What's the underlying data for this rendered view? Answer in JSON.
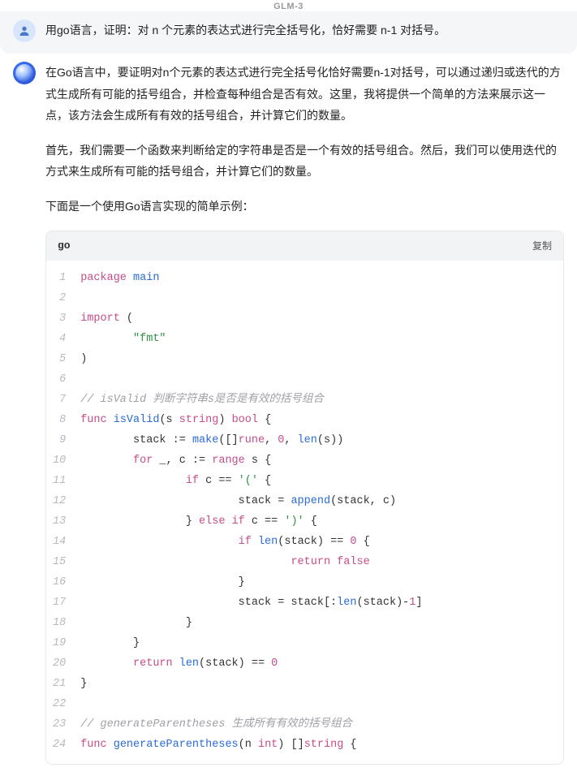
{
  "model_name": "GLM-3",
  "user": {
    "text": "用go语言，证明：对 n 个元素的表达式进行完全括号化，恰好需要 n-1 对括号。"
  },
  "assistant": {
    "paragraphs": [
      "在Go语言中，要证明对n个元素的表达式进行完全括号化恰好需要n-1对括号，可以通过递归或迭代的方式生成所有可能的括号组合，并检查每种组合是否有效。这里，我将提供一个简单的方法来展示这一点，该方法会生成所有有效的括号组合，并计算它们的数量。",
      "首先，我们需要一个函数来判断给定的字符串是否是一个有效的括号组合。然后，我们可以使用迭代的方式来生成所有可能的括号组合，并计算它们的数量。",
      "下面是一个使用Go语言实现的简单示例："
    ]
  },
  "code": {
    "language": "go",
    "copy_label": "复制",
    "lines": [
      {
        "n": 1,
        "tokens": [
          [
            "kw",
            "package"
          ],
          [
            "plain",
            " "
          ],
          [
            "fn",
            "main"
          ]
        ]
      },
      {
        "n": 2,
        "tokens": []
      },
      {
        "n": 3,
        "tokens": [
          [
            "kw",
            "import"
          ],
          [
            "plain",
            " ("
          ]
        ]
      },
      {
        "n": 4,
        "tokens": [
          [
            "plain",
            "        "
          ],
          [
            "str",
            "\"fmt\""
          ]
        ]
      },
      {
        "n": 5,
        "tokens": [
          [
            "plain",
            ")"
          ]
        ]
      },
      {
        "n": 6,
        "tokens": []
      },
      {
        "n": 7,
        "tokens": [
          [
            "comment",
            "// isValid 判断字符串s是否是有效的括号组合"
          ]
        ]
      },
      {
        "n": 8,
        "tokens": [
          [
            "kw",
            "func"
          ],
          [
            "plain",
            " "
          ],
          [
            "fn",
            "isValid"
          ],
          [
            "plain",
            "(s "
          ],
          [
            "type",
            "string"
          ],
          [
            "plain",
            ") "
          ],
          [
            "type",
            "bool"
          ],
          [
            "plain",
            " {"
          ]
        ]
      },
      {
        "n": 9,
        "tokens": [
          [
            "plain",
            "        stack := "
          ],
          [
            "fn",
            "make"
          ],
          [
            "plain",
            "([]"
          ],
          [
            "type",
            "rune"
          ],
          [
            "plain",
            ", "
          ],
          [
            "num",
            "0"
          ],
          [
            "plain",
            ", "
          ],
          [
            "fn",
            "len"
          ],
          [
            "plain",
            "(s))"
          ]
        ]
      },
      {
        "n": 10,
        "tokens": [
          [
            "plain",
            "        "
          ],
          [
            "kw",
            "for"
          ],
          [
            "plain",
            " _, c := "
          ],
          [
            "kw",
            "range"
          ],
          [
            "plain",
            " s {"
          ]
        ]
      },
      {
        "n": 11,
        "tokens": [
          [
            "plain",
            "                "
          ],
          [
            "kw",
            "if"
          ],
          [
            "plain",
            " c == "
          ],
          [
            "str",
            "'('"
          ],
          [
            "plain",
            " {"
          ]
        ]
      },
      {
        "n": 12,
        "tokens": [
          [
            "plain",
            "                        stack = "
          ],
          [
            "fn",
            "append"
          ],
          [
            "plain",
            "(stack, c)"
          ]
        ]
      },
      {
        "n": 13,
        "tokens": [
          [
            "plain",
            "                } "
          ],
          [
            "kw",
            "else"
          ],
          [
            "plain",
            " "
          ],
          [
            "kw",
            "if"
          ],
          [
            "plain",
            " c == "
          ],
          [
            "str",
            "')'"
          ],
          [
            "plain",
            " {"
          ]
        ]
      },
      {
        "n": 14,
        "tokens": [
          [
            "plain",
            "                        "
          ],
          [
            "kw",
            "if"
          ],
          [
            "plain",
            " "
          ],
          [
            "fn",
            "len"
          ],
          [
            "plain",
            "(stack) == "
          ],
          [
            "num",
            "0"
          ],
          [
            "plain",
            " {"
          ]
        ]
      },
      {
        "n": 15,
        "tokens": [
          [
            "plain",
            "                                "
          ],
          [
            "kw",
            "return"
          ],
          [
            "plain",
            " "
          ],
          [
            "bool",
            "false"
          ]
        ]
      },
      {
        "n": 16,
        "tokens": [
          [
            "plain",
            "                        }"
          ]
        ]
      },
      {
        "n": 17,
        "tokens": [
          [
            "plain",
            "                        stack = stack[:"
          ],
          [
            "fn",
            "len"
          ],
          [
            "plain",
            "(stack)-"
          ],
          [
            "num",
            "1"
          ],
          [
            "plain",
            "]"
          ]
        ]
      },
      {
        "n": 18,
        "tokens": [
          [
            "plain",
            "                }"
          ]
        ]
      },
      {
        "n": 19,
        "tokens": [
          [
            "plain",
            "        }"
          ]
        ]
      },
      {
        "n": 20,
        "tokens": [
          [
            "plain",
            "        "
          ],
          [
            "kw",
            "return"
          ],
          [
            "plain",
            " "
          ],
          [
            "fn",
            "len"
          ],
          [
            "plain",
            "(stack) == "
          ],
          [
            "num",
            "0"
          ]
        ]
      },
      {
        "n": 21,
        "tokens": [
          [
            "plain",
            "}"
          ]
        ]
      },
      {
        "n": 22,
        "tokens": []
      },
      {
        "n": 23,
        "tokens": [
          [
            "comment",
            "// generateParentheses 生成所有有效的括号组合"
          ]
        ]
      },
      {
        "n": 24,
        "tokens": [
          [
            "kw",
            "func"
          ],
          [
            "plain",
            " "
          ],
          [
            "fn",
            "generateParentheses"
          ],
          [
            "plain",
            "(n "
          ],
          [
            "type",
            "int"
          ],
          [
            "plain",
            ") []"
          ],
          [
            "type",
            "string"
          ],
          [
            "plain",
            " {"
          ]
        ]
      }
    ]
  }
}
